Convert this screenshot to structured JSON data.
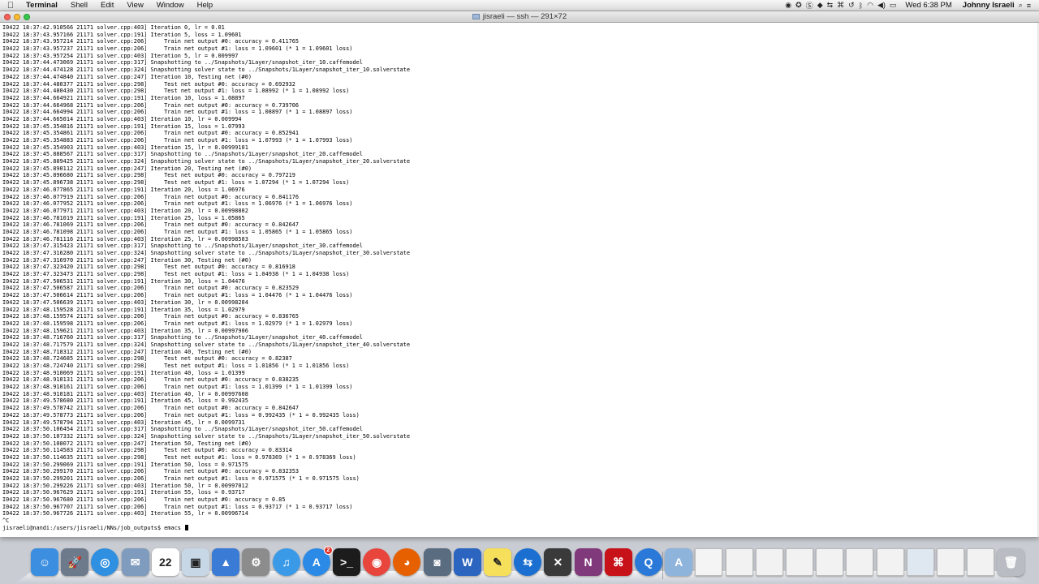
{
  "menubar": {
    "app_name": "Terminal",
    "menus": [
      "Shell",
      "Edit",
      "View",
      "Window",
      "Help"
    ],
    "clock": "Wed 6:38 PM",
    "user": "Johnny Israeli"
  },
  "window": {
    "title": "jisraeli — ssh — 291×72"
  },
  "terminal": {
    "lines": [
      "I0422 18:37:42.910566 21171 solver.cpp:403] Iteration 0, lr = 0.01",
      "I0422 18:37:43.957166 21171 solver.cpp:191] Iteration 5, loss = 1.09601",
      "I0422 18:37:43.957214 21171 solver.cpp:206]     Train net output #0: accuracy = 0.411765",
      "I0422 18:37:43.957237 21171 solver.cpp:206]     Train net output #1: loss = 1.09601 (* 1 = 1.09601 loss)",
      "I0422 18:37:43.957254 21171 solver.cpp:403] Iteration 5, lr = 0.009997",
      "I0422 18:37:44.473069 21171 solver.cpp:317] Snapshotting to ../Snapshots/1Layer/snapshot_iter_10.caffemodel",
      "I0422 18:37:44.474128 21171 solver.cpp:324] Snapshotting solver state to ../Snapshots/1Layer/snapshot_iter_10.solverstate",
      "I0422 18:37:44.474840 21171 solver.cpp:247] Iteration 10, Testing net (#0)",
      "I0422 18:37:44.480377 21171 solver.cpp:298]     Test net output #0: accuracy = 0.692932",
      "I0422 18:37:44.480430 21171 solver.cpp:298]     Test net output #1: loss = 1.08992 (* 1 = 1.08992 loss)",
      "I0422 18:37:44.664921 21171 solver.cpp:191] Iteration 10, loss = 1.08897",
      "I0422 18:37:44.664968 21171 solver.cpp:206]     Train net output #0: accuracy = 0.739706",
      "I0422 18:37:44.664994 21171 solver.cpp:206]     Train net output #1: loss = 1.08897 (* 1 = 1.08897 loss)",
      "I0422 18:37:44.665014 21171 solver.cpp:403] Iteration 10, lr = 0.009994",
      "I0422 18:37:45.354816 21171 solver.cpp:191] Iteration 15, loss = 1.07993",
      "I0422 18:37:45.354861 21171 solver.cpp:206]     Train net output #0: accuracy = 0.852941",
      "I0422 18:37:45.354883 21171 solver.cpp:206]     Train net output #1: loss = 1.07993 (* 1 = 1.07993 loss)",
      "I0422 18:37:45.354903 21171 solver.cpp:403] Iteration 15, lr = 0.00999101",
      "I0422 18:37:45.888567 21171 solver.cpp:317] Snapshotting to ../Snapshots/1Layer/snapshot_iter_20.caffemodel",
      "I0422 18:37:45.889425 21171 solver.cpp:324] Snapshotting solver state to ../Snapshots/1Layer/snapshot_iter_20.solverstate",
      "I0422 18:37:45.890112 21171 solver.cpp:247] Iteration 20, Testing net (#0)",
      "I0422 18:37:45.896680 21171 solver.cpp:298]     Test net output #0: accuracy = 0.797219",
      "I0422 18:37:45.896738 21171 solver.cpp:298]     Test net output #1: loss = 1.07294 (* 1 = 1.07294 loss)",
      "I0422 18:37:46.077865 21171 solver.cpp:191] Iteration 20, loss = 1.06976",
      "I0422 18:37:46.077919 21171 solver.cpp:206]     Train net output #0: accuracy = 0.841176",
      "I0422 18:37:46.077952 21171 solver.cpp:206]     Train net output #1: loss = 1.06976 (* 1 = 1.06976 loss)",
      "I0422 18:37:46.077971 21171 solver.cpp:403] Iteration 20, lr = 0.00998802",
      "I0422 18:37:46.781019 21171 solver.cpp:191] Iteration 25, loss = 1.05865",
      "I0422 18:37:46.781069 21171 solver.cpp:206]     Train net output #0: accuracy = 0.842647",
      "I0422 18:37:46.781098 21171 solver.cpp:206]     Train net output #1: loss = 1.05865 (* 1 = 1.05865 loss)",
      "I0422 18:37:46.781116 21171 solver.cpp:403] Iteration 25, lr = 0.00998503",
      "I0422 18:37:47.315423 21171 solver.cpp:317] Snapshotting to ../Snapshots/1Layer/snapshot_iter_30.caffemodel",
      "I0422 18:37:47.316280 21171 solver.cpp:324] Snapshotting solver state to ../Snapshots/1Layer/snapshot_iter_30.solverstate",
      "I0422 18:37:47.316970 21171 solver.cpp:247] Iteration 30, Testing net (#0)",
      "I0422 18:37:47.323420 21171 solver.cpp:298]     Test net output #0: accuracy = 0.816918",
      "I0422 18:37:47.323473 21171 solver.cpp:298]     Test net output #1: loss = 1.04938 (* 1 = 1.04938 loss)",
      "I0422 18:37:47.506531 21171 solver.cpp:191] Iteration 30, loss = 1.04476",
      "I0422 18:37:47.506587 21171 solver.cpp:206]     Train net output #0: accuracy = 0.823529",
      "I0422 18:37:47.506614 21171 solver.cpp:206]     Train net output #1: loss = 1.04476 (* 1 = 1.04476 loss)",
      "I0422 18:37:47.506639 21171 solver.cpp:403] Iteration 30, lr = 0.00998204",
      "I0422 18:37:48.159528 21171 solver.cpp:191] Iteration 35, loss = 1.02979",
      "I0422 18:37:48.159574 21171 solver.cpp:206]     Train net output #0: accuracy = 0.836765",
      "I0422 18:37:48.159598 21171 solver.cpp:206]     Train net output #1: loss = 1.02979 (* 1 = 1.02979 loss)",
      "I0422 18:37:48.159621 21171 solver.cpp:403] Iteration 35, lr = 0.00997906",
      "I0422 18:37:48.716760 21171 solver.cpp:317] Snapshotting to ../Snapshots/1Layer/snapshot_iter_40.caffemodel",
      "I0422 18:37:48.717579 21171 solver.cpp:324] Snapshotting solver state to ../Snapshots/1Layer/snapshot_iter_40.solverstate",
      "I0422 18:37:48.718312 21171 solver.cpp:247] Iteration 40, Testing net (#0)",
      "I0422 18:37:48.724685 21171 solver.cpp:298]     Test net output #0: accuracy = 0.82387",
      "I0422 18:37:48.724740 21171 solver.cpp:298]     Test net output #1: loss = 1.01856 (* 1 = 1.01856 loss)",
      "I0422 18:37:48.910069 21171 solver.cpp:191] Iteration 40, loss = 1.01399",
      "I0422 18:37:48.910131 21171 solver.cpp:206]     Train net output #0: accuracy = 0.838235",
      "I0422 18:37:48.910161 21171 solver.cpp:206]     Train net output #1: loss = 1.01399 (* 1 = 1.01399 loss)",
      "I0422 18:37:48.910181 21171 solver.cpp:403] Iteration 40, lr = 0.00997608",
      "I0422 18:37:49.578680 21171 solver.cpp:191] Iteration 45, loss = 0.992435",
      "I0422 18:37:49.578742 21171 solver.cpp:206]     Train net output #0: accuracy = 0.842647",
      "I0422 18:37:49.578773 21171 solver.cpp:206]     Train net output #1: loss = 0.992435 (* 1 = 0.992435 loss)",
      "I0422 18:37:49.578794 21171 solver.cpp:403] Iteration 45, lr = 0.0099731",
      "I0422 18:37:50.106454 21171 solver.cpp:317] Snapshotting to ../Snapshots/1Layer/snapshot_iter_50.caffemodel",
      "I0422 18:37:50.107332 21171 solver.cpp:324] Snapshotting solver state to ../Snapshots/1Layer/snapshot_iter_50.solverstate",
      "I0422 18:37:50.108072 21171 solver.cpp:247] Iteration 50, Testing net (#0)",
      "I0422 18:37:50.114583 21171 solver.cpp:298]     Test net output #0: accuracy = 0.83314",
      "I0422 18:37:50.114635 21171 solver.cpp:298]     Test net output #1: loss = 0.978369 (* 1 = 0.978369 loss)",
      "I0422 18:37:50.299069 21171 solver.cpp:191] Iteration 50, loss = 0.971575",
      "I0422 18:37:50.299170 21171 solver.cpp:206]     Train net output #0: accuracy = 0.832353",
      "I0422 18:37:50.299201 21171 solver.cpp:206]     Train net output #1: loss = 0.971575 (* 1 = 0.971575 loss)",
      "I0422 18:37:50.299226 21171 solver.cpp:403] Iteration 50, lr = 0.00997012",
      "I0422 18:37:50.967629 21171 solver.cpp:191] Iteration 55, loss = 0.93717",
      "I0422 18:37:50.967680 21171 solver.cpp:206]     Train net output #0: accuracy = 0.85",
      "I0422 18:37:50.967707 21171 solver.cpp:206]     Train net output #1: loss = 0.93717 (* 1 = 0.93717 loss)",
      "I0422 18:37:50.967726 21171 solver.cpp:403] Iteration 55, lr = 0.00996714",
      "^C"
    ],
    "prompt": "jisraeli@nandi:/users/jisraeli/NNs/job_outputs$ emacs "
  },
  "dock": {
    "items": [
      {
        "name": "finder",
        "icon": "finder-icon",
        "color": "#3b8ee0",
        "glyph": "☺"
      },
      {
        "name": "launchpad",
        "icon": "rocket-icon",
        "color": "#6d7a8c",
        "glyph": "🚀"
      },
      {
        "name": "safari",
        "icon": "compass-icon",
        "color": "#2f8fe0",
        "glyph": "◎"
      },
      {
        "name": "mail",
        "icon": "stamp-icon",
        "color": "#7f9bbd",
        "glyph": "✉"
      },
      {
        "name": "calendar",
        "icon": "calendar-icon",
        "color": "#ffffff",
        "glyph": "22"
      },
      {
        "name": "preview",
        "icon": "photos-icon",
        "color": "#c8d7e6",
        "glyph": "▣"
      },
      {
        "name": "keynote",
        "icon": "podium-icon",
        "color": "#3a7bd5",
        "glyph": "▲"
      },
      {
        "name": "system-preferences",
        "icon": "gear-icon",
        "color": "#8c8c8c",
        "glyph": "⚙"
      },
      {
        "name": "itunes",
        "icon": "music-note-icon",
        "color": "#3a9ae8",
        "glyph": "♫"
      },
      {
        "name": "app-store",
        "icon": "app-store-icon",
        "color": "#2b8ae6",
        "glyph": "A",
        "badge": "2"
      },
      {
        "name": "terminal",
        "icon": "terminal-icon",
        "color": "#1c1c1c",
        "glyph": ">_"
      },
      {
        "name": "chrome",
        "icon": "chrome-icon",
        "color": "#e8453c",
        "glyph": "◉"
      },
      {
        "name": "firefox",
        "icon": "firefox-icon",
        "color": "#e66000",
        "glyph": "◕"
      },
      {
        "name": "image-capture",
        "icon": "camera-icon",
        "color": "#5a6c80",
        "glyph": "◙"
      },
      {
        "name": "word",
        "icon": "word-icon",
        "color": "#2b65c0",
        "glyph": "W"
      },
      {
        "name": "stickies",
        "icon": "sticky-note-icon",
        "color": "#f6df5b",
        "glyph": "✎"
      },
      {
        "name": "teamviewer",
        "icon": "teamviewer-icon",
        "color": "#1a6fd0",
        "glyph": "⇆"
      },
      {
        "name": "x11",
        "icon": "x11-icon",
        "color": "#3a3a3a",
        "glyph": "✕"
      },
      {
        "name": "onenote",
        "icon": "onenote-icon",
        "color": "#80397b",
        "glyph": "N"
      },
      {
        "name": "acrobat",
        "icon": "pdf-icon",
        "color": "#c8121a",
        "glyph": "⌘"
      },
      {
        "name": "quicktime",
        "icon": "quicktime-icon",
        "color": "#2a79d8",
        "glyph": "Q"
      },
      {
        "name": "applications-folder",
        "icon": "folder-icon",
        "color": "#8fb4db",
        "glyph": "A"
      },
      {
        "name": "document-1",
        "icon": "document-icon",
        "color": "#f4f4f4",
        "glyph": ""
      },
      {
        "name": "minimized-window-1",
        "icon": "window-thumbnail-icon",
        "color": "#f2f2f2",
        "glyph": ""
      },
      {
        "name": "minimized-window-2",
        "icon": "window-thumbnail-icon",
        "color": "#f2f2f2",
        "glyph": ""
      },
      {
        "name": "minimized-window-3",
        "icon": "window-thumbnail-icon",
        "color": "#f2f2f2",
        "glyph": ""
      },
      {
        "name": "minimized-window-4",
        "icon": "window-thumbnail-icon",
        "color": "#f2f2f2",
        "glyph": ""
      },
      {
        "name": "minimized-window-5",
        "icon": "window-thumbnail-icon",
        "color": "#f2f2f2",
        "glyph": ""
      },
      {
        "name": "minimized-window-6",
        "icon": "window-thumbnail-icon",
        "color": "#f2f2f2",
        "glyph": ""
      },
      {
        "name": "minimized-window-7",
        "icon": "window-thumbnail-icon",
        "color": "#dfe7f0",
        "glyph": ""
      },
      {
        "name": "minimized-window-8",
        "icon": "window-thumbnail-icon",
        "color": "#f2f2f2",
        "glyph": ""
      },
      {
        "name": "minimized-window-9",
        "icon": "window-thumbnail-icon",
        "color": "#f2f2f2",
        "glyph": ""
      },
      {
        "name": "trash",
        "icon": "trash-icon",
        "color": "#b9bcc2",
        "glyph": "🗑"
      }
    ]
  }
}
